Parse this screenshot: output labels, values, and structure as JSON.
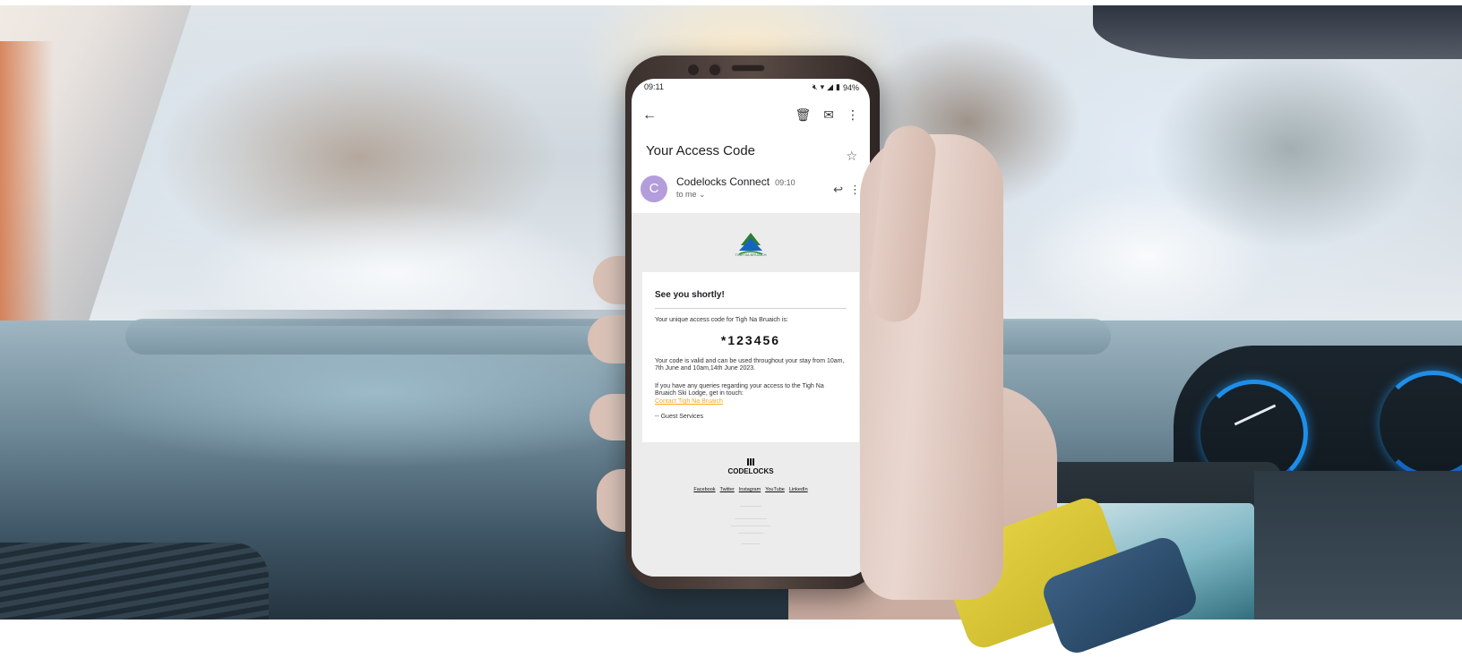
{
  "status_bar": {
    "time": "09:11",
    "battery": "94%"
  },
  "email": {
    "subject": "Your Access Code",
    "avatar_letter": "C",
    "sender": "Codelocks Connect",
    "sent_time": "09:10",
    "recipient": "to me"
  },
  "body": {
    "logo_caption": "TIGH NA BRUAICH",
    "heading": "See you shortly!",
    "intro": "Your unique access code for Tigh Na Bruaich is:",
    "code": "*123456",
    "validity": "Your code is valid and can be used throughout your stay from 10am, 7th June and 10am,14th June 2023.",
    "queries": "If you have any queries regarding your access to the Tigh Na Bruaich Ski Lodge, get in touch:",
    "contact_link": "Contact Tigh Na Bruaich",
    "signoff": "-- Guest Services"
  },
  "footer": {
    "brand": "CODELOCKS",
    "links": [
      "Facebook",
      "Twitter",
      "Instagram",
      "YouTube",
      "LinkedIn"
    ]
  },
  "icons": [
    "back-arrow-icon",
    "delete-icon",
    "mail-icon",
    "more-vert-icon",
    "star-icon",
    "reply-icon",
    "chevron-down-icon"
  ],
  "colors": {
    "avatar": "#b39ddb",
    "link": "#f9a825",
    "logo_green": "#2e7d32",
    "logo_blue": "#1565c0"
  }
}
